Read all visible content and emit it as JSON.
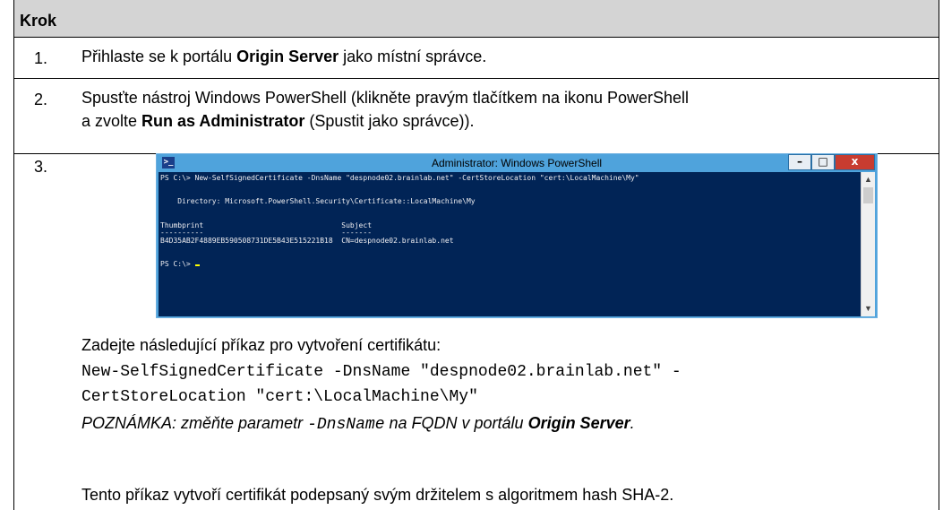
{
  "header": {
    "title": "Krok"
  },
  "steps": [
    {
      "num": "1.",
      "pre": "Přihlaste se k portálu ",
      "bold": "Origin Server",
      "post": " jako místní správce."
    },
    {
      "num": "2.",
      "line1": "Spusťte nástroj Windows PowerShell (klikněte pravým tlačítkem na ikonu PowerShell",
      "line2_pre": "a zvolte ",
      "line2_bold": "Run as Administrator",
      "line2_post": " (Spustit jako správce))."
    },
    {
      "num": "3."
    }
  ],
  "powershell": {
    "title": "Administrator: Windows PowerShell",
    "lines": [
      "PS C:\\> New-SelfSignedCertificate -DnsName \"despnode02.brainlab.net\" -CertStoreLocation \"cert:\\LocalMachine\\My\"",
      "    Directory: Microsoft.PowerShell.Security\\Certificate::LocalMachine\\My",
      "Thumbprint                                Subject",
      "----------                                -------",
      "B4D35AB2F4889EB590508731DE5B43E515221B18  CN=despnode02.brainlab.net",
      "PS C:\\> "
    ]
  },
  "step3": {
    "intro": "Zadejte následující příkaz pro vytvoření certifikátu:",
    "cmd_line1": "New-SelfSignedCertificate -DnsName \"despnode02.brainlab.net\" -",
    "cmd_line2": "CertStoreLocation \"cert:\\LocalMachine\\My\"",
    "note_pre": "POZNÁMKA: změňte parametr ",
    "note_code": "-DnsName",
    "note_mid": " na FQDN v portálu ",
    "note_bold": "Origin Server",
    "note_post": ".",
    "outro": "Tento příkaz vytvoří certifikát podepsaný svým držitelem s algoritmem hash SHA-2."
  }
}
